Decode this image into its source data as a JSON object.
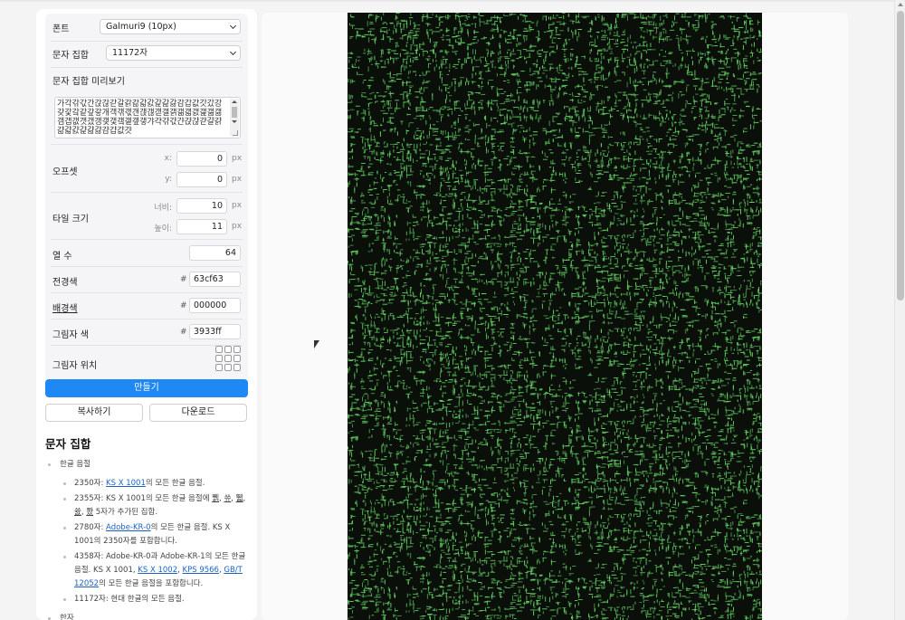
{
  "form": {
    "font_label": "폰트",
    "font_value": "Galmuri9 (10px)",
    "charset_label": "문자 집합",
    "charset_value": "11172자",
    "preview_label": "문자 집합 미리보기",
    "preview_text": "가각갂갃간갅갆갇갈갉갊갋갌갍갎갏감갑값갓갔강갖갗갘같갚갛개객갞갟갠갡갢갣갤갥갦갧갨갩갪갫갬갭갮갯갰갱갲갳갴갵갶갷갸갹갺갻갼갽갾갿걀걁걂걃걄걅걆걇걈걉걊걋",
    "offset_label": "오프셋",
    "offset_x_label": "x:",
    "offset_x_value": "0",
    "offset_y_label": "y:",
    "offset_y_value": "0",
    "tile_label": "타일 크기",
    "tile_width_label": "너비:",
    "tile_width_value": "10",
    "tile_height_label": "높이:",
    "tile_height_value": "11",
    "unit_px": "px",
    "columns_label": "열 수",
    "columns_value": "64",
    "fg_label": "전경색",
    "fg_value": "63cf63",
    "bg_label": "배경색",
    "bg_value": "000000",
    "shadow_color_label": "그림자 색",
    "shadow_color_value": "3933ff",
    "shadow_pos_label": "그림자 위치",
    "hash": "#"
  },
  "buttons": {
    "make": "만들기",
    "copy": "복사하기",
    "download": "다운로드"
  },
  "charset_section": {
    "title": "문자 집합",
    "group_hangul": "한글 음절",
    "items": [
      {
        "prefix": "2350자: ",
        "link": "KS X 1001",
        "suffix": "의 모든 한글 음절."
      },
      {
        "text1": "2355자: KS X 1001의 모든 한글 음절에 ",
        "u1": "쀍",
        "sep1": ", ",
        "u2": "쓔",
        "sep2": ", ",
        "u3": "쀏",
        "sep3": ", ",
        "u4": "쓠",
        "sep4": ", ",
        "u5": "쫬",
        "text2": " 5자가 추가된 집합."
      },
      {
        "prefix": "2780자: ",
        "link": "Adobe-KR-0",
        "suffix": "의 모든 한글 음절. KS X 1001의 2350자를 포함합니다."
      },
      {
        "prefix": "4358자: Adobe-KR-0과 Adobe-KR-1의 모든 한글 음절. KS X 1001, ",
        "link1": "KS X 1002",
        "sep1": ", ",
        "link2": "KPS 9566",
        "sep2": ", ",
        "link3": "GB/T 12052",
        "suffix": "의 모든 한글 음절을 포함합니다."
      },
      {
        "text": "11172자: 현대 한글의 모든 음절."
      }
    ],
    "group_hanja": "한자"
  },
  "colors": {
    "primary": "#1e88f5",
    "foreground": "#63cf63",
    "background": "#000000",
    "shadow": "#3933ff"
  }
}
